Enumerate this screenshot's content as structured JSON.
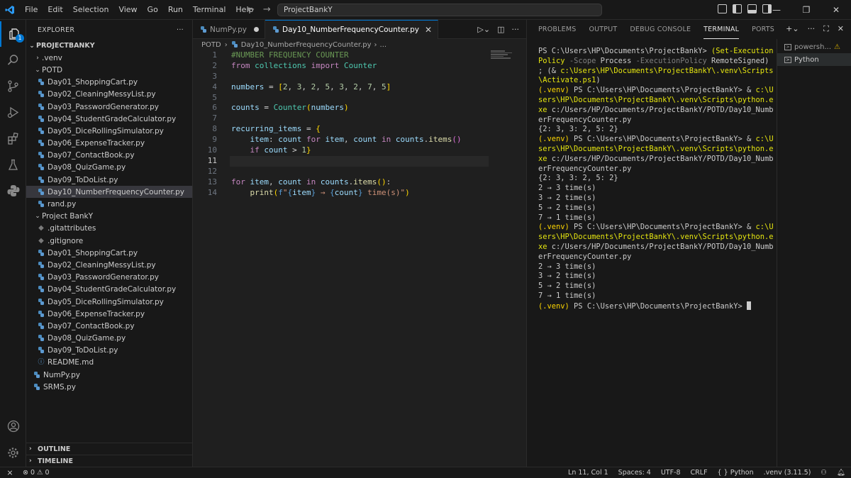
{
  "title_bar": {
    "menu": [
      "File",
      "Edit",
      "Selection",
      "View",
      "Go",
      "Run",
      "Terminal",
      "Help"
    ],
    "search_text": "ProjectBankY"
  },
  "activity_bar": {
    "explorer_badge": "1"
  },
  "sidebar": {
    "header": "EXPLORER",
    "more": "···",
    "root": "PROJECTBANKY",
    "venv": ".venv",
    "potd_folder": "POTD",
    "potd_files": [
      "Day01_ShoppingCart.py",
      "Day02_CleaningMessyList.py",
      "Day03_PasswordGenerator.py",
      "Day04_StudentGradeCalculator.py",
      "Day05_DiceRollingSimulator.py",
      "Day06_ExpenseTracker.py",
      "Day07_ContactBook.py",
      "Day08_QuizGame.py",
      "Day09_ToDoList.py",
      "Day10_NumberFrequencyCounter.py",
      "rand.py"
    ],
    "project_folder": "Project BankY",
    "project_files": [
      ".gitattributes",
      ".gitignore",
      "Day01_ShoppingCart.py",
      "Day02_CleaningMessyList.py",
      "Day03_PasswordGenerator.py",
      "Day04_StudentGradeCalculator.py",
      "Day05_DiceRollingSimulator.py",
      "Day06_ExpenseTracker.py",
      "Day07_ContactBook.py",
      "Day08_QuizGame.py",
      "Day09_ToDoList.py",
      "README.md"
    ],
    "root_files": [
      "NumPy.py",
      "SRMS.py"
    ],
    "outline": "OUTLINE",
    "timeline": "TIMELINE"
  },
  "editor": {
    "tabs": [
      {
        "label": "NumPy.py"
      },
      {
        "label": "Day10_NumberFrequencyCounter.py"
      }
    ],
    "breadcrumb": {
      "folder": "POTD",
      "file": "Day10_NumberFrequencyCounter.py",
      "more": "..."
    },
    "line_numbers": [
      "1",
      "2",
      "3",
      "4",
      "5",
      "6",
      "7",
      "8",
      "9",
      "10",
      "11",
      "12",
      "13",
      "14"
    ]
  },
  "panel": {
    "tabs": [
      "PROBLEMS",
      "OUTPUT",
      "DEBUG CONSOLE",
      "TERMINAL",
      "PORTS"
    ],
    "terminals": [
      "powersh...",
      "Python"
    ]
  },
  "status_bar": {
    "errors": "0",
    "warnings": "0",
    "position": "Ln 11, Col 1",
    "spaces": "Spaces: 4",
    "encoding": "UTF-8",
    "eol": "CRLF",
    "language": "Python",
    "interpreter": ".venv (3.11.5)"
  }
}
